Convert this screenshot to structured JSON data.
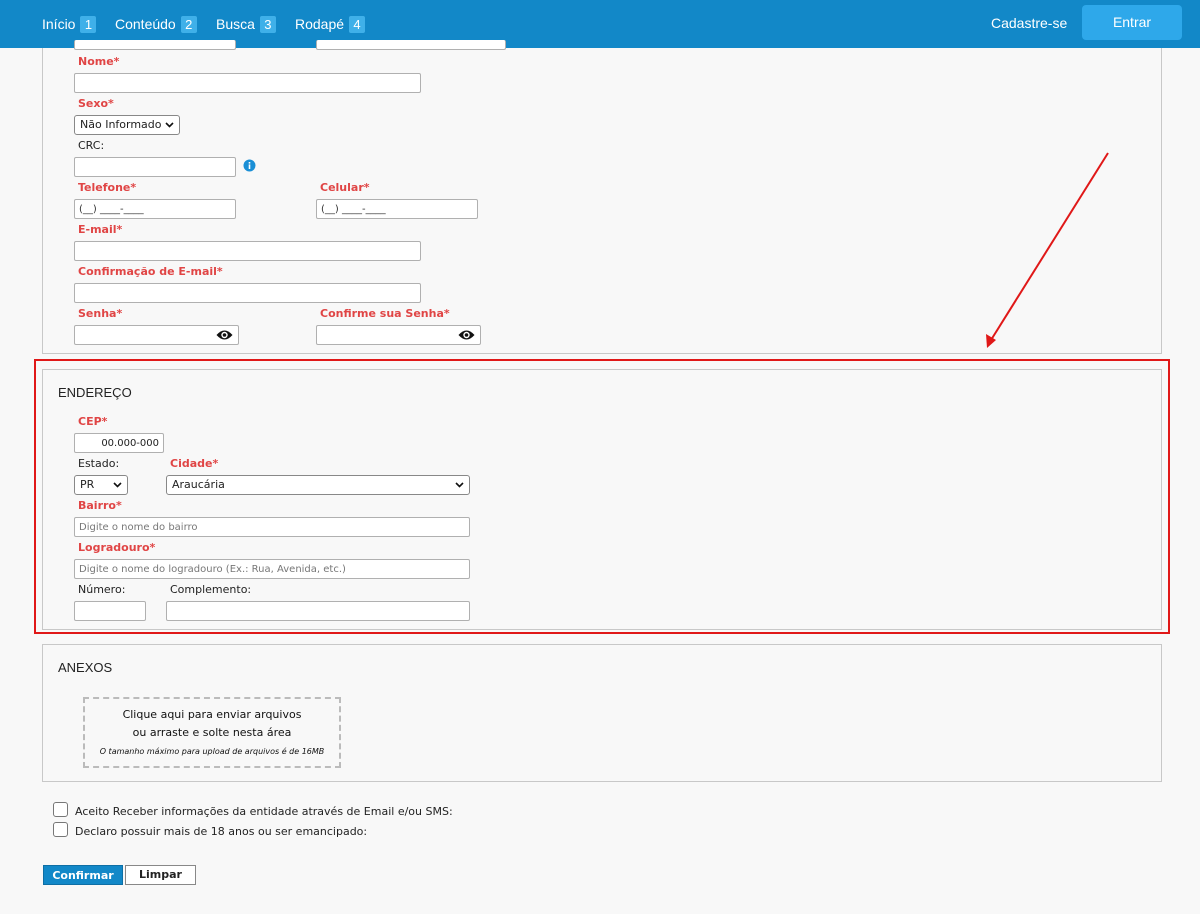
{
  "nav": {
    "items": [
      {
        "label": "Início",
        "badge": "1"
      },
      {
        "label": "Conteúdo",
        "badge": "2"
      },
      {
        "label": "Busca",
        "badge": "3"
      },
      {
        "label": "Rodapé",
        "badge": "4"
      }
    ],
    "signup_label": "Cadastre-se",
    "login_label": "Entrar"
  },
  "personal": {
    "nome_label": "Nome*",
    "sexo_label": "Sexo*",
    "sexo_value": "Não Informado",
    "crc_label": "CRC:",
    "telefone_label": "Telefone*",
    "telefone_value": "(__) ____-____",
    "celular_label": "Celular*",
    "celular_value": "(__) ____-____",
    "email_label": "E-mail*",
    "email_confirm_label": "Confirmação de E-mail*",
    "senha_label": "Senha*",
    "senha_confirm_label": "Confirme sua Senha*"
  },
  "address": {
    "title": "ENDEREÇO",
    "cep_label": "CEP*",
    "cep_value": "00.000-000",
    "estado_label": "Estado:",
    "estado_value": "PR",
    "cidade_label": "Cidade*",
    "cidade_value": "Araucária",
    "bairro_label": "Bairro*",
    "bairro_placeholder": "Digite o nome do bairro",
    "logradouro_label": "Logradouro*",
    "logradouro_placeholder": "Digite o nome do logradouro (Ex.: Rua, Avenida, etc.)",
    "numero_label": "Número:",
    "complemento_label": "Complemento:"
  },
  "attachments": {
    "title": "ANEXOS",
    "drop_line1": "Clique aqui para enviar arquivos",
    "drop_line2": "ou arraste e solte nesta área",
    "drop_note": "O tamanho máximo para upload de arquivos é de 16MB"
  },
  "consents": {
    "accept_info": "Aceito Receber informações da entidade através de Email e/ou SMS:",
    "age_declaration": "Declaro possuir mais de 18 anos ou ser emancipado:"
  },
  "actions": {
    "confirm_label": "Confirmar",
    "clear_label": "Limpar"
  },
  "colors": {
    "header": "#1288c8",
    "required_label": "#e04545",
    "highlight": "#e01818",
    "info_icon": "#1a8fd6"
  }
}
